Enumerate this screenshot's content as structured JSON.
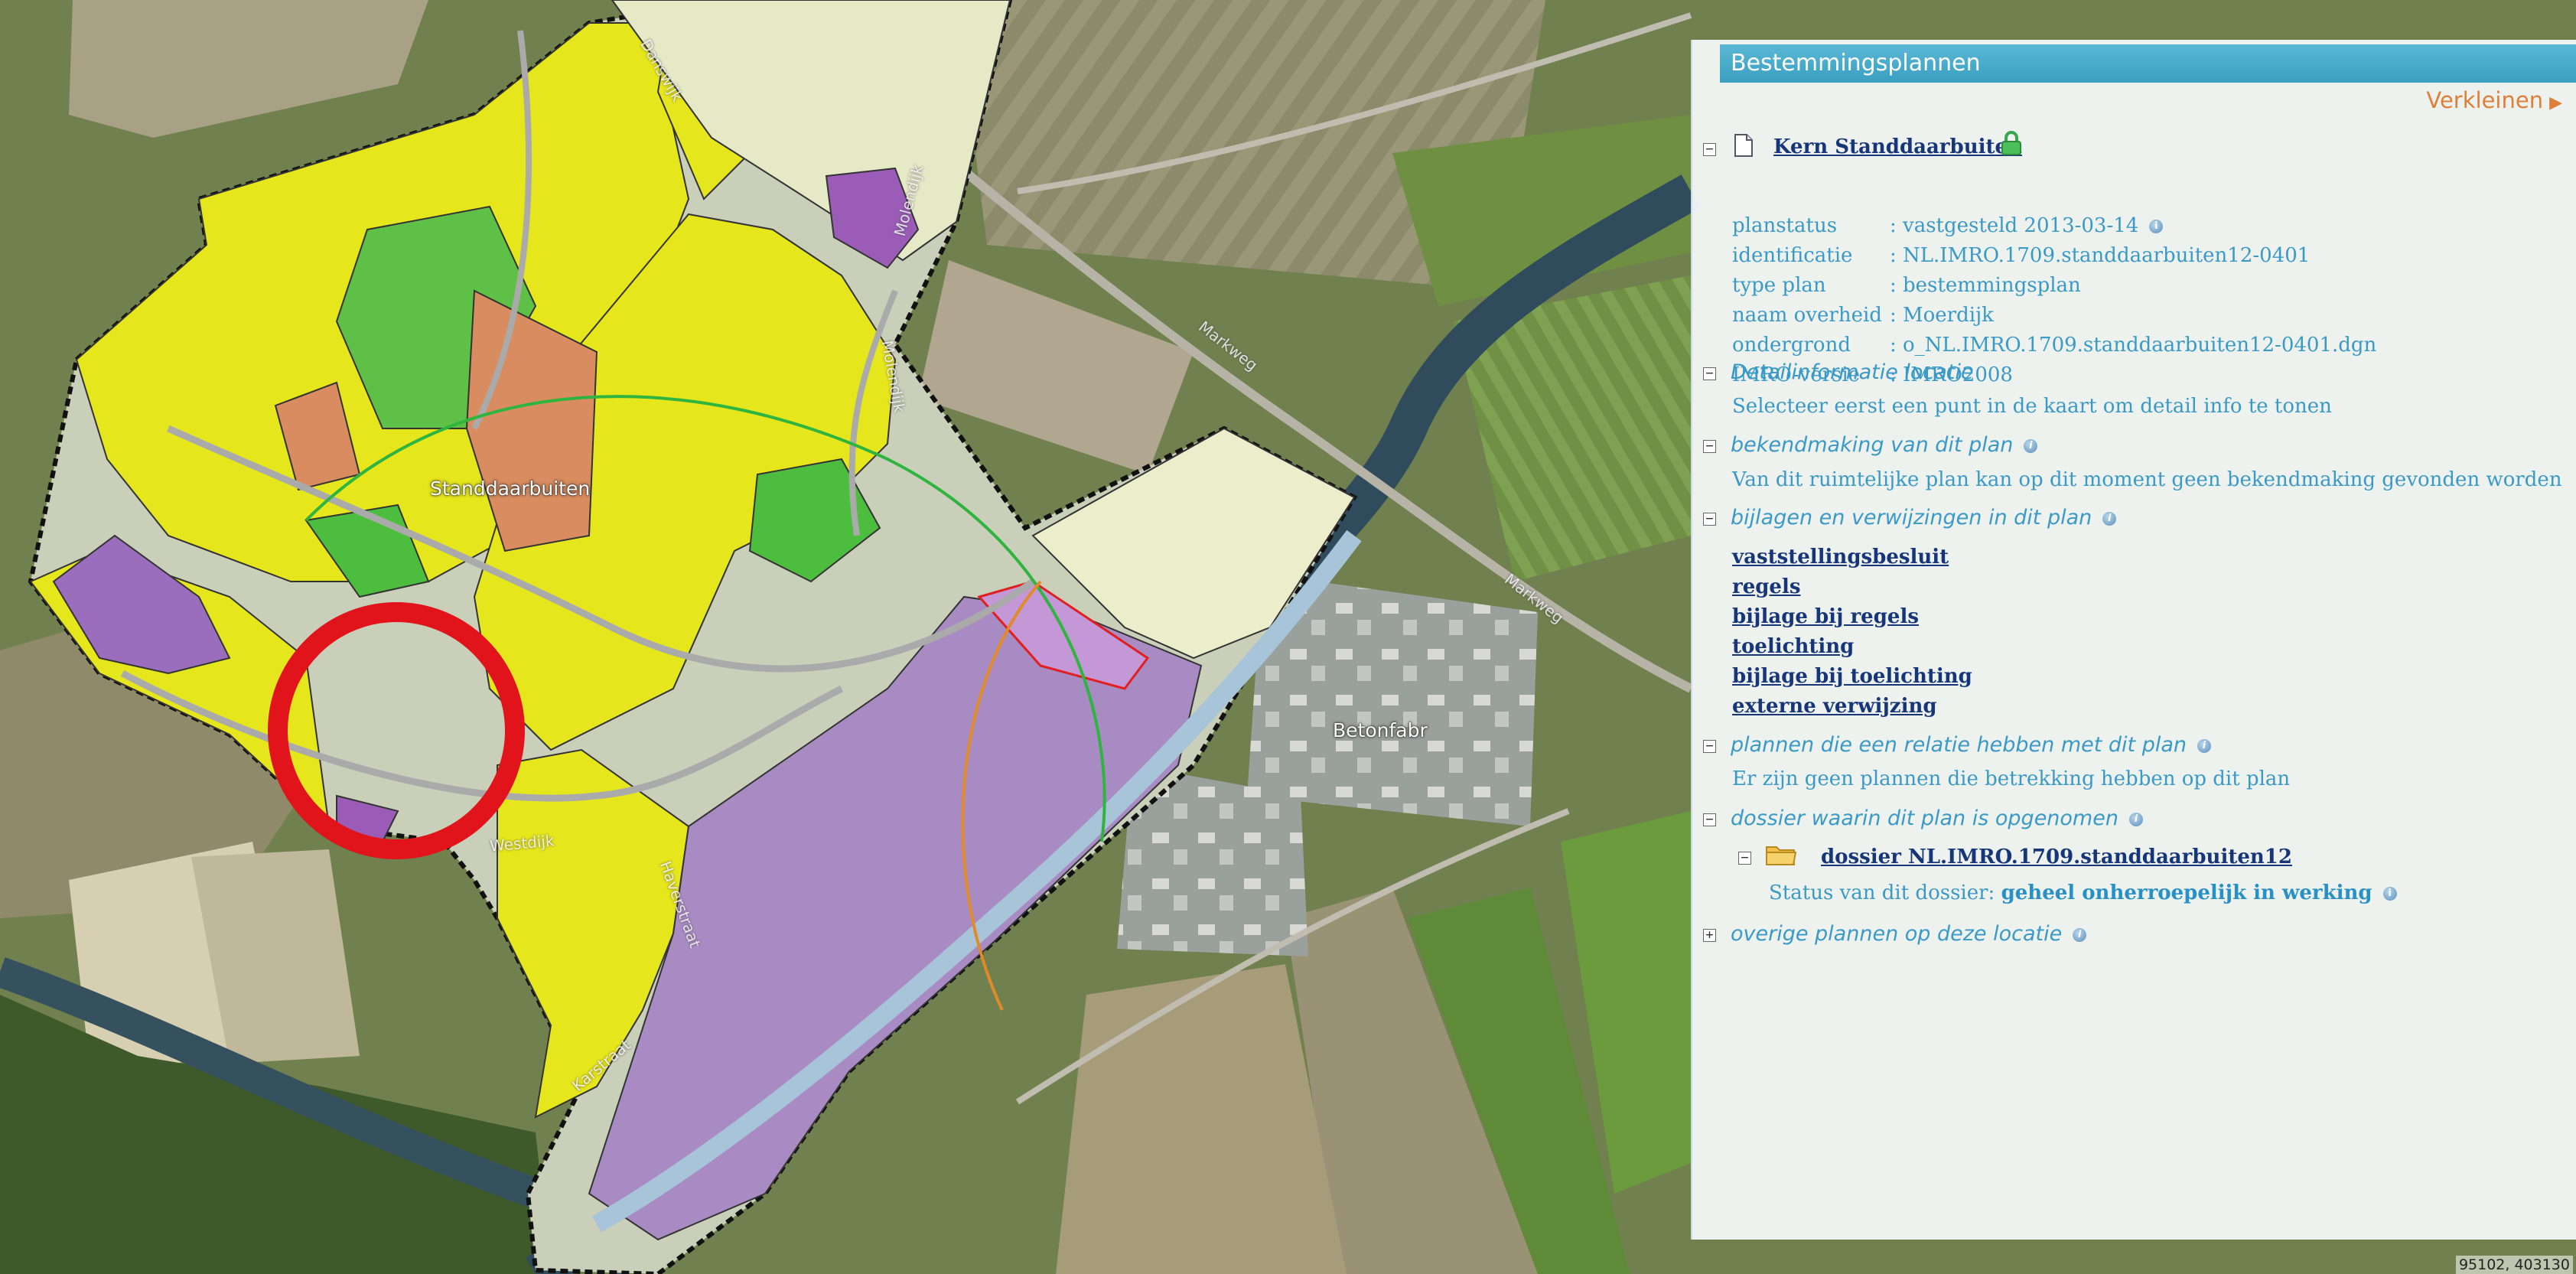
{
  "map": {
    "place_label": "Standdaarbuiten",
    "poi_label": "Betonfabr",
    "coordinates": "95102, 403130",
    "streets": [
      "Molendijk",
      "Danswijk",
      "Molendijk",
      "Markweg",
      "Markweg",
      "Westdijk",
      "Haverstraat",
      "Karstraat"
    ],
    "colors": {
      "residential": "#e8e81a",
      "business": "#a98bc4",
      "green": "#5ec046",
      "social": "#d98c5f",
      "agricultural": "#e8ebc7",
      "water": "#a8c4d8",
      "highlight_circle": "#e0141a"
    }
  },
  "panel": {
    "title": "Bestemmingsplannen",
    "shrink_label": "Verkleinen",
    "plan": {
      "name": "Kern Standdaarbuiten",
      "properties": [
        {
          "key": "planstatus",
          "value": ": vastgesteld 2013-03-14",
          "info": true
        },
        {
          "key": "identificatie",
          "value": ": NL.IMRO.1709.standdaarbuiten12-0401",
          "info": false
        },
        {
          "key": "type plan",
          "value": ": bestemmingsplan",
          "info": false
        },
        {
          "key": "naam overheid",
          "value": ": Moerdijk",
          "info": false
        },
        {
          "key": "ondergrond",
          "value": ": o_NL.IMRO.1709.standdaarbuiten12-0401.dgn",
          "info": false
        },
        {
          "key": "IMRO-versie",
          "value": ": IMRO2008",
          "info": false
        }
      ]
    },
    "sections": {
      "detail_title": "Detailinformatie locatie",
      "detail_text": "Selecteer eerst een punt in de kaart om detail info te tonen",
      "bekendmaking_title": "bekendmaking van dit plan",
      "bekendmaking_text": "Van dit ruimtelijke plan kan op dit moment geen bekendmaking gevonden worden",
      "bijlagen_title": "bijlagen en verwijzingen in dit plan",
      "bijlagen_links": [
        "vaststellingsbesluit",
        "regels",
        "bijlage bij regels",
        "toelichting",
        "bijlage bij toelichting",
        "externe verwijzing"
      ],
      "relatie_title": "plannen die een relatie hebben met dit plan",
      "relatie_text": "Er zijn geen plannen die betrekking hebben op dit plan",
      "dossier_title": "dossier waarin dit plan is opgenomen",
      "dossier_link": "dossier NL.IMRO.1709.standdaarbuiten12",
      "dossier_status_label": "Status van dit dossier:",
      "dossier_status_value": "geheel onherroepelijk in werking",
      "overige_title": "overige plannen op deze locatie"
    },
    "icons": {
      "plan_doc": "document-icon",
      "lock": "lock-icon",
      "folder": "folder-icon",
      "info": "info-icon"
    }
  }
}
